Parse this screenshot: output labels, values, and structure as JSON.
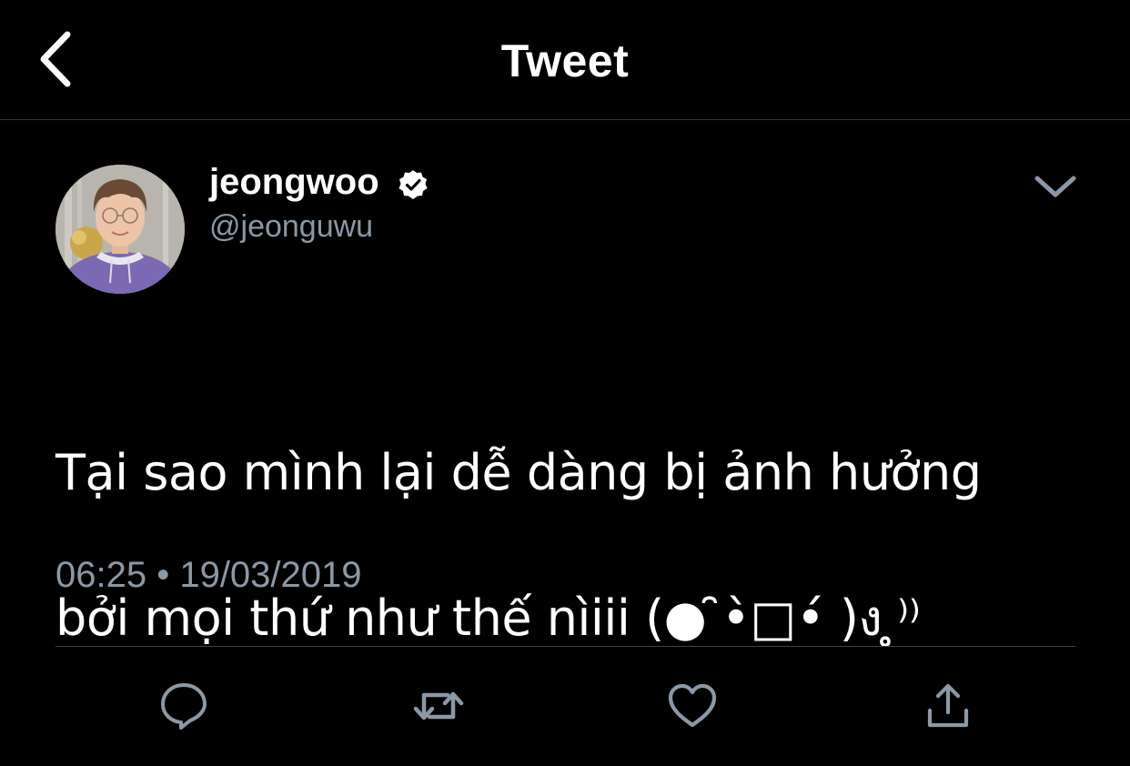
{
  "header": {
    "title": "Tweet",
    "back_icon": "chevron-left-icon"
  },
  "tweet": {
    "author": {
      "display_name": "jeongwoo",
      "handle": "@jeonguwu",
      "verified": true
    },
    "text": "Tại sao mình lại dễ dàng bị ảnh hưởng\nbởi mọi thứ như thế nìiii (● ̮̮̃•̃ ̮̮̃•̃ )۶ु⁾⁾",
    "text_display_line1": "Tại sao mình lại dễ dàng bị ảnh hưởng",
    "text_display_line2": "bởi mọi thứ như thế nìiii (● ̑•̀□•́ )ง ̥̥̥̥⁾⁾",
    "timestamp": "06:25 • 19/03/2019"
  },
  "actions": {
    "reply_icon": "reply-icon",
    "retweet_icon": "retweet-icon",
    "like_icon": "heart-icon",
    "share_icon": "share-icon"
  },
  "colors": {
    "background": "#000000",
    "text": "#ffffff",
    "secondary_text": "#8b98a5",
    "divider": "#38444d",
    "icon": "#8b98a5"
  }
}
